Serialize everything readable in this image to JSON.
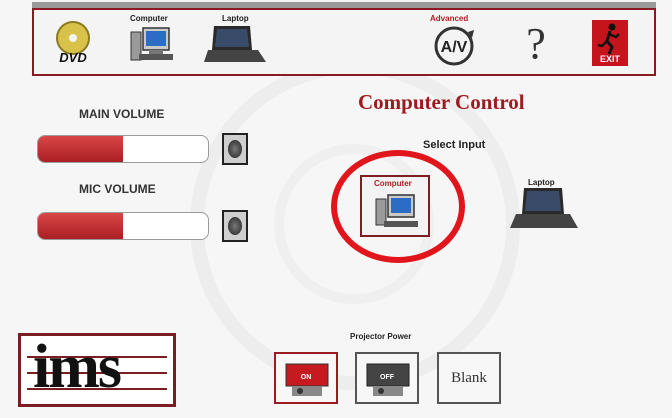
{
  "toolbar": {
    "dvd_label": "DVD",
    "computer_label": "Computer",
    "laptop_label": "Laptop",
    "advanced_label": "Advanced",
    "av_label": "A/V",
    "help_label": "?",
    "exit_label": "EXIT"
  },
  "volume": {
    "main": {
      "label": "MAIN VOLUME",
      "level": 0.5
    },
    "mic": {
      "label": "MIC VOLUME",
      "level": 0.5
    }
  },
  "page_title": "Computer Control",
  "select_input": {
    "label": "Select Input",
    "computer_label": "Computer",
    "laptop_label": "Laptop",
    "selected": "Computer"
  },
  "logo": {
    "text": "ims"
  },
  "projector": {
    "label": "Projector Power",
    "on_label": "ON",
    "off_label": "OFF",
    "blank_label": "Blank"
  },
  "colors": {
    "accent": "#9c1b20",
    "highlight": "#e1161c",
    "slider_fill": "#c0303a"
  }
}
